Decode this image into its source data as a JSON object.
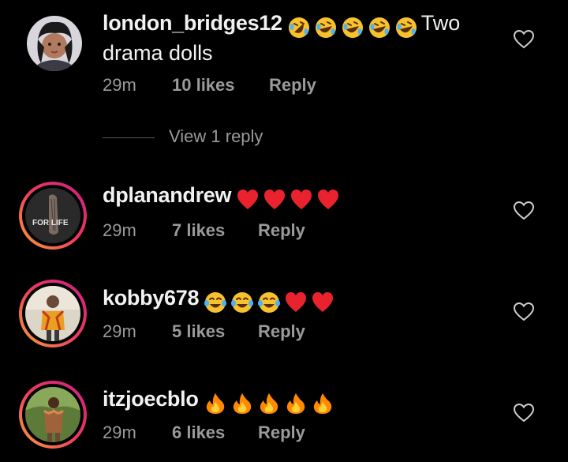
{
  "comments": [
    {
      "username": "london_bridges12",
      "emojis": [
        "rofl",
        "rofl",
        "rofl",
        "rofl",
        "rofl"
      ],
      "text_after": "Two",
      "text_line2": "drama dolls",
      "time": "29m",
      "likes": "10 likes",
      "reply": "Reply",
      "has_story_ring": false
    },
    {
      "username": "dplanandrew",
      "emojis": [
        "red-heart",
        "red-heart",
        "red-heart",
        "red-heart"
      ],
      "time": "29m",
      "likes": "7 likes",
      "reply": "Reply",
      "has_story_ring": true,
      "avatar_text": "FOR LIFE"
    },
    {
      "username": "kobby678",
      "emojis": [
        "tears-of-joy",
        "tears-of-joy",
        "tears-of-joy",
        "red-heart",
        "red-heart"
      ],
      "time": "29m",
      "likes": "5 likes",
      "reply": "Reply",
      "has_story_ring": true
    },
    {
      "username": "itzjoecblo",
      "emojis": [
        "fire",
        "fire",
        "fire",
        "fire",
        "fire"
      ],
      "time": "29m",
      "likes": "6 likes",
      "reply": "Reply",
      "has_story_ring": true
    }
  ],
  "view_replies": "View 1 reply",
  "colors": {
    "background": "#000000",
    "text": "#f2f2f2",
    "meta": "#9a9a9a",
    "ring_start": "#f9a13a",
    "ring_mid": "#ee3b5d",
    "ring_end": "#c81f88",
    "heart": "#e8232e",
    "emoji_yellow": "#f7c22d",
    "fire": "#ff8a00"
  }
}
